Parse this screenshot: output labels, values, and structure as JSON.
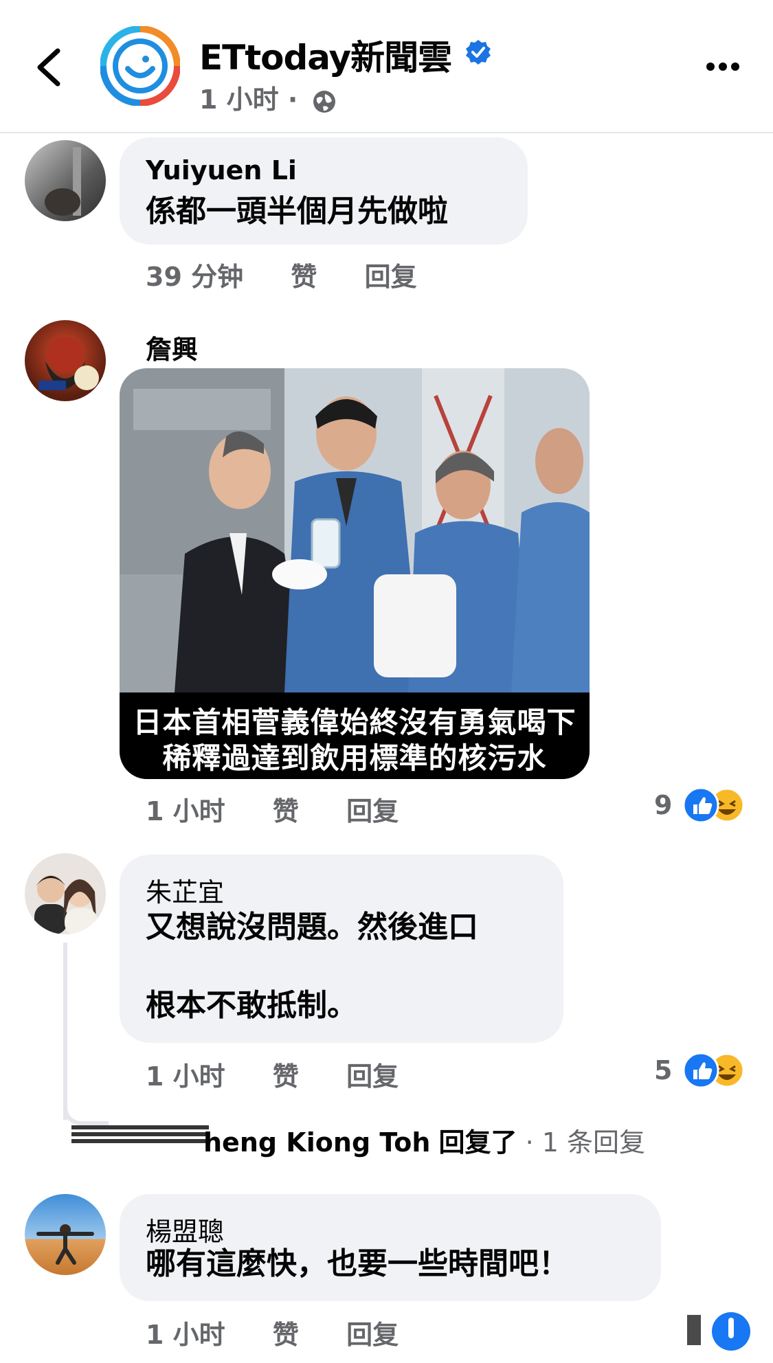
{
  "header": {
    "page_name": "ETtoday新聞雲",
    "time": "1 小时",
    "separator": "·"
  },
  "comments": [
    {
      "author": "Yuiyuen Li",
      "text": "係都一頭半個月先做啦",
      "time": "39 分钟",
      "like": "赞",
      "reply": "回复"
    },
    {
      "author": "詹興",
      "image_caption_line1": "日本首相菅義偉始終沒有勇氣喝下",
      "image_caption_line2": "稀釋過達到飲用標準的核污水",
      "time": "1 小时",
      "like": "赞",
      "reply": "回复",
      "reaction_count": "9"
    },
    {
      "author": "朱芷宜",
      "text_line1": "又想說沒問題。然後進口",
      "text_line2": "根本不敢抵制。",
      "time": "1 小时",
      "like": "赞",
      "reply": "回复",
      "reaction_count": "5"
    },
    {
      "author": "楊盟聰",
      "text": "哪有這麼快，也要一些時間吧！",
      "time": "1 小时",
      "like": "赞",
      "reply": "回复"
    }
  ],
  "thread_reply": {
    "name": "heng Kiong Toh",
    "action": "回复了",
    "count": "· 1 条回复"
  },
  "colors": {
    "verified_blue": "#1b74e4",
    "like_blue": "#1877f2",
    "haha_yellow": "#f7b928",
    "bubble_gray": "#f0f2f5",
    "meta_gray": "#65676b"
  }
}
